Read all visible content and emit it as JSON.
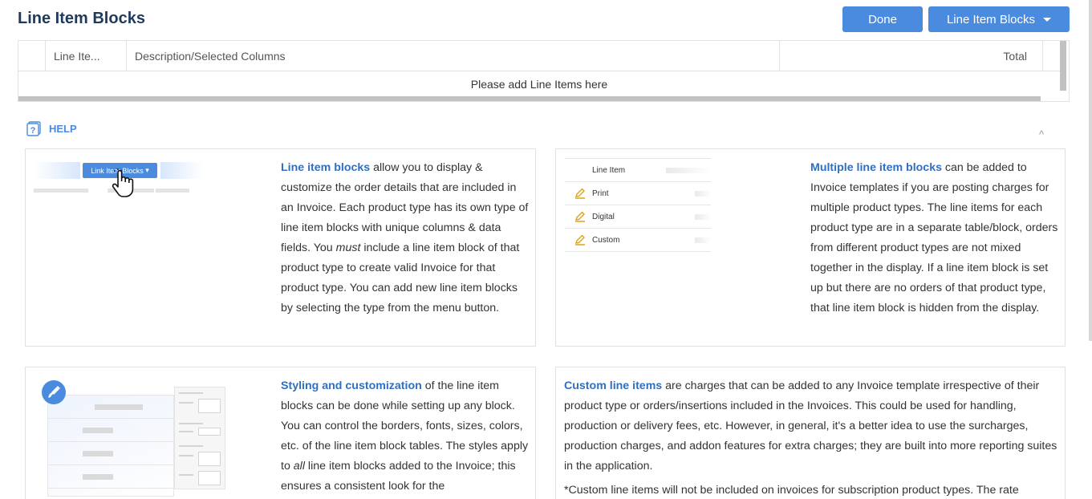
{
  "header": {
    "title": "Line Item Blocks",
    "done_label": "Done",
    "library_label": "Line Item Blocks"
  },
  "grid": {
    "columns": [
      "",
      "Line Ite...",
      "Description/Selected Columns",
      "Total",
      ""
    ],
    "empty_message": "Please add Line Items here"
  },
  "help": {
    "label": "HELP",
    "collapse_glyph": "^",
    "cards": {
      "line_item_blocks": {
        "illustration_button": "Link Item Blocks",
        "title": "Line item blocks",
        "p1": " allow you to display & customize the order details that are included in an Invoice. Each product type has its own type of line item blocks with unique columns & data fields. You ",
        "em": "must",
        "p2": " include a line item block of that product type to create valid Invoice for that product type. You can add new line item blocks by selecting the type from the menu button."
      },
      "multiple_blocks": {
        "illustration_rows": [
          "Line Item",
          "Print",
          "Digital",
          "Custom"
        ],
        "title": "Multiple line item blocks",
        "body": " can be added to Invoice templates if you are posting charges for multiple product types. The line items for each product type are in a separate table/block, orders from different product types are not mixed together in the display. If a line item block is set up but there are no orders of that product type, that line item block is hidden from the display."
      },
      "styling": {
        "title": "Styling and customization",
        "p1": " of the line item blocks can be done while setting up any block. You can control the borders, fonts, sizes, colors, etc. of the line item block tables. The styles apply to ",
        "em": "all",
        "p2": " line item blocks added to the Invoice; this ensures a consistent look for the"
      },
      "custom_items": {
        "title": "Custom line items",
        "body": " are charges that can be added to any Invoice template irrespective of their product type or orders/insertions included in the Invoices. This could be used for handling, production or delivery fees, etc. However, in general, it's a better idea to use the surcharges, production charges, and addon features for extra charges; they are built into more reporting suites in the application.",
        "note": "*Custom line items will not be included on invoices for subscription product types. The rate"
      }
    }
  },
  "colors": {
    "accent": "#4a8be0",
    "title": "#1f3a5c",
    "link": "#2f6fc1",
    "pencil": "#e0a21a"
  }
}
